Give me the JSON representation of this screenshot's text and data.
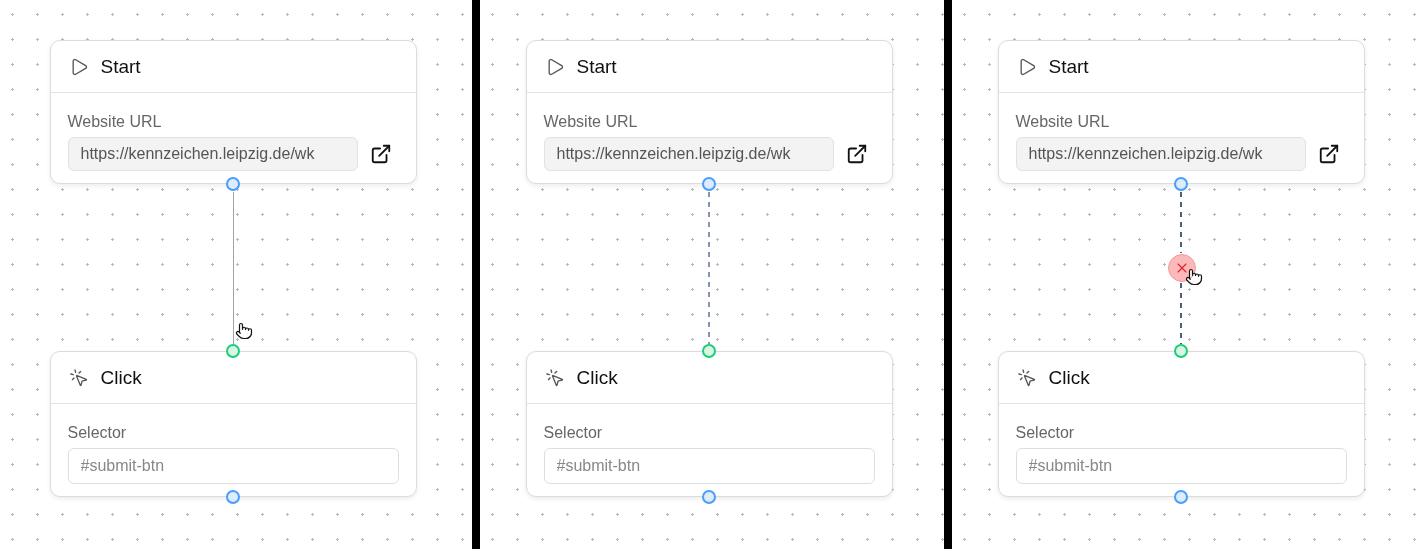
{
  "panels": [
    {
      "nodes": [
        {
          "kind": "start",
          "title": "Start",
          "field_label": "Website URL",
          "value": "https://kennzeichen.leipzig.de/wk"
        },
        {
          "kind": "click",
          "title": "Click",
          "field_label": "Selector",
          "placeholder": "#submit-btn"
        }
      ],
      "edge": {
        "kind": "solid",
        "color": "#a3a3a3",
        "delete_button": false,
        "hovered": true
      }
    },
    {
      "nodes": [
        {
          "kind": "start",
          "title": "Start",
          "field_label": "Website URL",
          "value": "https://kennzeichen.leipzig.de/wk"
        },
        {
          "kind": "click",
          "title": "Click",
          "field_label": "Selector",
          "placeholder": "#submit-btn"
        }
      ],
      "edge": {
        "kind": "dashed",
        "color": "#8593b0",
        "delete_button": false,
        "hovered": false
      }
    },
    {
      "nodes": [
        {
          "kind": "start",
          "title": "Start",
          "field_label": "Website URL",
          "value": "https://kennzeichen.leipzig.de/wk"
        },
        {
          "kind": "click",
          "title": "Click",
          "field_label": "Selector",
          "placeholder": "#submit-btn"
        }
      ],
      "edge": {
        "kind": "dashed",
        "color": "#4f5d7a",
        "delete_button": true,
        "hovered": true
      }
    }
  ]
}
